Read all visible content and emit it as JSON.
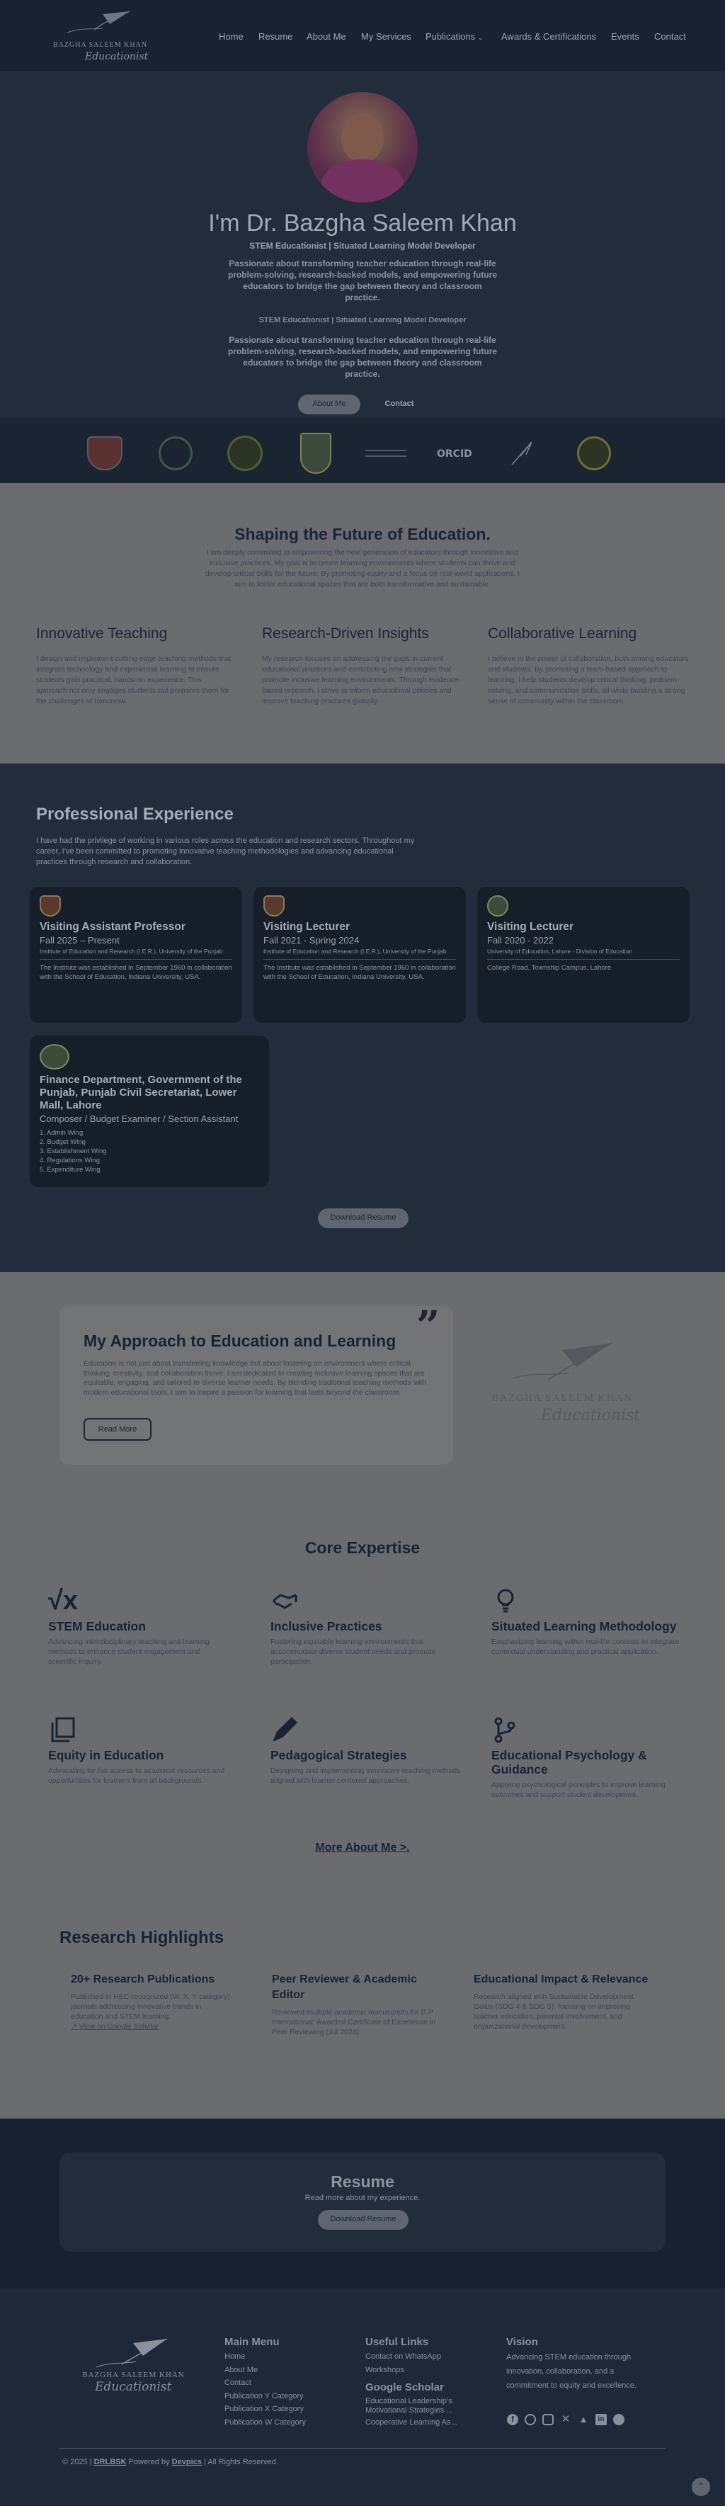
{
  "header": {
    "logo_text": "BAZGHA SALEEM KHAN",
    "logo_script": "Educationist",
    "nav": [
      "Home",
      "Resume",
      "About Me",
      "My Services",
      "Publications",
      "Awards & Certifications",
      "Events",
      "Contact"
    ]
  },
  "hero": {
    "title": "I'm Dr. Bazgha Saleem Khan",
    "subtitle": "STEM Educationist | Situated Learning Model Developer",
    "tagline": "Passionate about transforming teacher education through real-life problem-solving, research-backed models, and empowering future educators to bridge the gap between theory and classroom practice.",
    "ghost_subtitle": "STEM Educationist | Situated Learning Model Developer",
    "ghost_tagline": "Passionate about transforming teacher education through real-life problem-solving, research-backed models, and empowering future educators to bridge the gap between theory and classroom practice.",
    "btn_about": "About Me",
    "btn_contact": "Contact"
  },
  "vision": {
    "title": "Shaping the Future of Education.",
    "intro": "I am deeply committed to empowering the next generation of educators through innovative and inclusive practices. My goal is to create learning environments where students can thrive and develop critical skills for the future. By promoting equity and a focus on real-world applications, I aim to foster educational spaces that are both transformative and sustainable.",
    "columns": [
      {
        "title": "Innovative Teaching",
        "text": "I design and implement cutting-edge teaching methods that integrate technology and experiential learning to ensure students gain practical, hands-on experience. This approach not only engages students but prepares them for the challenges of tomorrow."
      },
      {
        "title": "Research-Driven Insights",
        "text": "My research focuses on addressing the gaps in current educational practices and contributing new strategies that promote inclusive learning environments. Through evidence-based research, I strive to inform educational policies and improve teaching practices globally."
      },
      {
        "title": "Collaborative Learning",
        "text": "I believe in the power of collaboration, both among educators and students. By promoting a team-based approach to learning, I help students develop critical thinking, problem-solving, and communication skills, all while building a strong sense of community within the classroom."
      }
    ]
  },
  "experience": {
    "title": "Professional Experience",
    "intro": "I have had the privilege of working in various roles across the education and research sectors. Throughout my career, I've been committed to promoting innovative teaching methodologies and advancing educational practices through research and collaboration.",
    "cards": [
      {
        "title": "Visiting Assistant Professor",
        "period": "Fall 2025 – Present",
        "inst": "Institute of Education and Research (I.E.R.), University of the Punjab",
        "desc": "The Institute was established in September 1960 in collaboration with the School of Education, Indiana University, USA."
      },
      {
        "title": "Visiting Lecturer",
        "period": "Fall 2021 - Spring 2024",
        "inst": "Institute of Education and Research (I.E.R.), University of the Punjab",
        "desc": "The Institute was established in September 1960 in collaboration with the School of Education, Indiana University, USA."
      },
      {
        "title": "Visiting Lecturer",
        "period": "Fall 2020 - 2022",
        "inst": "University of Education, Lahore - Division of Education",
        "desc": "College Road, Township Campus, Lahore"
      },
      {
        "title": "Finance Department, Government of the Punjab, Punjab Civil Secretariat, Lower Mall, Lahore",
        "period": "Composer / Budget Examiner / Section Assistant",
        "inst": "",
        "desc": "1. Admin Wing\n2. Budget Wing\n3. Establishment Wing\n4. Regulations Wing\n5. Expenditure Wing"
      }
    ],
    "download_btn": "Download Resume"
  },
  "approach": {
    "title": "My Approach to Education and Learning",
    "text": "Education is not just about transferring knowledge but about fostering an environment where critical thinking, creativity, and collaboration thrive. I am dedicated to creating inclusive learning spaces that are equitable, engaging, and tailored to diverse learner needs. By blending traditional teaching methods with modern educational tools, I aim to inspire a passion for learning that lasts beyond the classroom.",
    "read_more": "Read More",
    "logo_text": "BAZGHA SALEEM KHAN",
    "logo_script": "Educationist"
  },
  "expertise": {
    "title": "Core Expertise",
    "items": [
      {
        "icon": "square-root-icon",
        "title": "STEM Education",
        "text": "Advancing interdisciplinary teaching and learning methods to enhance student engagement and scientific inquiry."
      },
      {
        "icon": "handshake-icon",
        "title": "Inclusive Practices",
        "text": "Fostering equitable learning environments that accommodate diverse student needs and promote participation."
      },
      {
        "icon": "lightbulb-icon",
        "title": "Situated Learning Methodology",
        "text": "Emphasizing learning within real-life contexts to integrate contextual understanding and practical application."
      },
      {
        "icon": "copy-icon",
        "title": "Equity in Education",
        "text": "Advocating for fair access to academic resources and opportunities for learners from all backgrounds."
      },
      {
        "icon": "pencil-icon",
        "title": "Pedagogical Strategies",
        "text": "Designing and implementing innovative teaching methods aligned with learner-centered approaches."
      },
      {
        "icon": "branch-icon",
        "title": "Educational Psychology & Guidance",
        "text": "Applying psychological principles to improve learning outcomes and support student development."
      }
    ],
    "more_link": "More About Me >."
  },
  "research": {
    "title": "Research Highlights",
    "items": [
      {
        "title": "20+ Research Publications",
        "text": "Published in HEC-recognized (W, X, Y category) journals addressing innovative trends in education and STEM learning.",
        "link": "↗ View on Google Scholar"
      },
      {
        "title": "Peer Reviewer & Academic Editor",
        "text": "Reviewed multiple academic manuscripts for B.P International; Awarded Certificate of Excellence in Peer Reviewing (Jul 2024).",
        "link": ""
      },
      {
        "title": "Educational Impact & Relevance",
        "text": "Research aligned with Sustainable Development Goals (SDG 4 & SDG 5), focusing on improving teacher education, parental involvement, and organizational development.",
        "link": ""
      }
    ]
  },
  "resume": {
    "title": "Resume",
    "text": "Read more about my experience.",
    "btn": "Download Resume"
  },
  "footer": {
    "logo_text": "BAZGHA SALEEM KHAN",
    "logo_script": "Educationist",
    "menu_title": "Main Menu",
    "menu": [
      "Home",
      "About Me",
      "Contact",
      "Publication Y Category",
      "Publication X Category",
      "Publication W Category"
    ],
    "links_title": "Useful Links",
    "links": [
      "Contact on WhatsApp",
      "Workshops"
    ],
    "scholar_title": "Google Scholar",
    "scholar": [
      "Educational Leadership's Motivational Strategies ...",
      "Cooperative Learning As..."
    ],
    "vision_title": "Vision",
    "vision_text": "Advancing STEM education through innovation, collaboration, and a commitment to equity and excellence.",
    "copyright_pre": "© 2025 |",
    "copyright_brand": "DRLBSK",
    "copyright_mid": "Powered by",
    "copyright_dev": "Devpics",
    "copyright_post": "| All Rights Reserved."
  }
}
